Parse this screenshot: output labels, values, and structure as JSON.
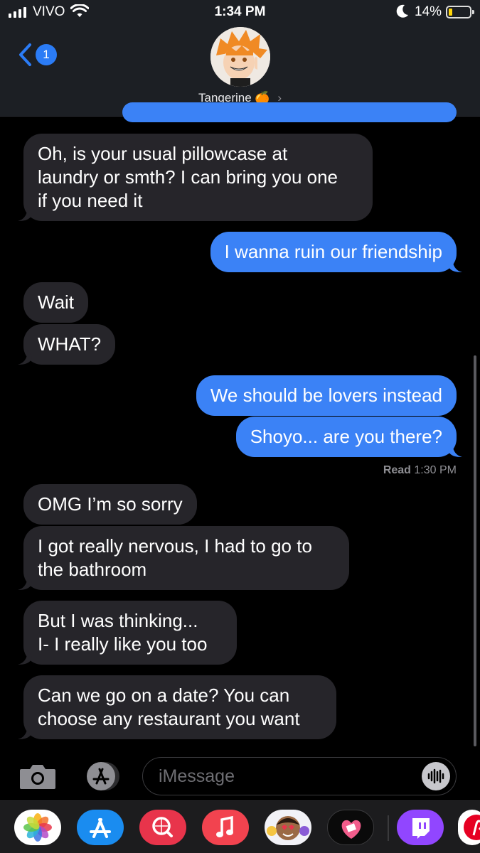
{
  "status_bar": {
    "carrier": "VIVO",
    "time": "1:34 PM",
    "battery_percent": "14%",
    "icons": [
      "signal-icon",
      "wifi-icon",
      "moon-icon",
      "battery-icon"
    ]
  },
  "header": {
    "back_badge": "1",
    "contact_name": "Tangerine",
    "contact_emoji": "🍊",
    "chevron": "›"
  },
  "messages": [
    {
      "side": "received",
      "lines": [
        "Oh, is your usual pillowcase at",
        "laundry or smth? I can bring you one",
        "if you need it"
      ]
    },
    {
      "side": "sent",
      "lines": [
        "I wanna ruin our friendship"
      ]
    },
    {
      "side": "received",
      "lines": [
        "Wait"
      ]
    },
    {
      "side": "received",
      "lines": [
        "WHAT?"
      ]
    },
    {
      "side": "sent",
      "lines": [
        "We should be lovers instead"
      ]
    },
    {
      "side": "sent",
      "lines": [
        "Shoyo... are you there?"
      ]
    },
    {
      "side": "received",
      "lines": [
        "OMG I’m so sorry"
      ]
    },
    {
      "side": "received",
      "lines": [
        "I got really nervous, I had to go to",
        "the bathroom"
      ]
    },
    {
      "side": "received",
      "lines": [
        "But I was thinking...",
        "I- I really like you too"
      ]
    },
    {
      "side": "received",
      "lines": [
        "Can we go on a date? You can",
        "choose any restaurant you want"
      ]
    }
  ],
  "read_receipt": {
    "label": "Read",
    "time": "1:30 PM"
  },
  "input": {
    "placeholder": "iMessage"
  },
  "dock": {
    "apps": [
      "photos",
      "app-store",
      "web-search",
      "music",
      "memoji",
      "heart-stickers",
      "twitch",
      "pinterest"
    ]
  },
  "colors": {
    "sent_bubble": "#3b82f6",
    "received_bubble": "#26252a",
    "badge": "#2b7cf6",
    "battery_low": "#ffd60a"
  }
}
